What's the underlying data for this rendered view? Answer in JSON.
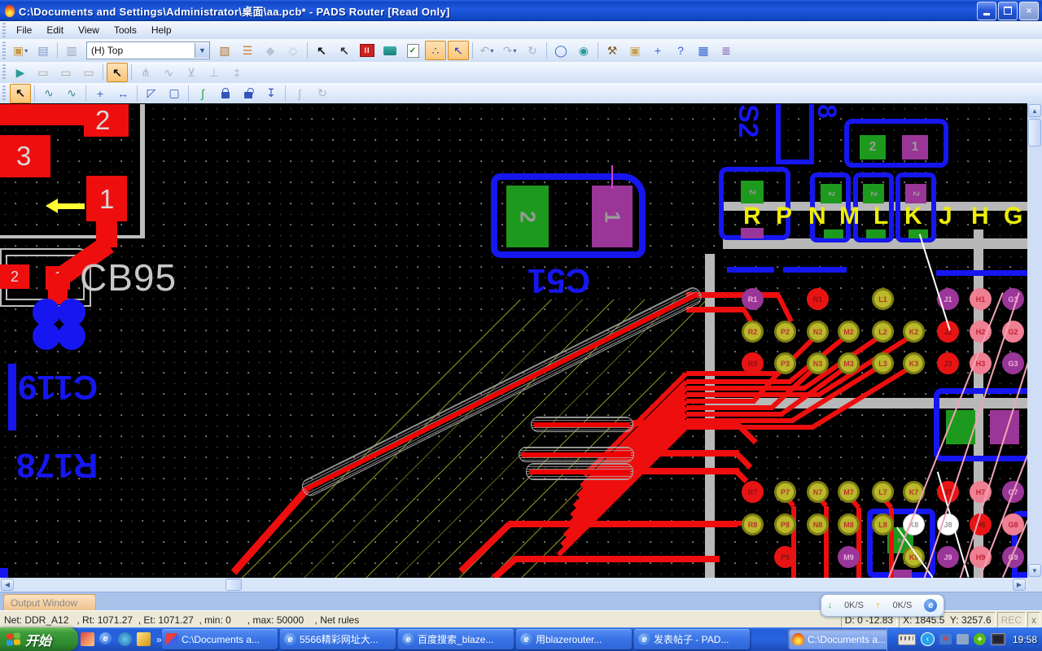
{
  "window": {
    "title": "C:\\Documents and Settings\\Administrator\\桌面\\aa.pcb* - PADS Router [Read Only]",
    "app_icon": "pads-flame-icon",
    "buttons": {
      "minimize": "minimize",
      "restore": "restore",
      "close": "close"
    }
  },
  "menu": {
    "items": [
      "File",
      "Edit",
      "View",
      "Tools",
      "Help"
    ]
  },
  "toolbars": {
    "layer_combo": {
      "value": "(H) Top"
    },
    "row1": [
      {
        "n": "open-icon",
        "g": "▣",
        "c": "#c89a4a",
        "dd": true
      },
      {
        "n": "save-icon",
        "g": "▤",
        "c": "#7d95c8"
      },
      {
        "n": "sep"
      },
      {
        "n": "print-icon",
        "g": "▥",
        "c": "#9aa8bc"
      },
      {
        "n": "combo"
      },
      {
        "n": "properties-icon",
        "g": "▧",
        "c": "#b07830"
      },
      {
        "n": "list-icon",
        "g": "☰",
        "c": "#d08030"
      },
      {
        "n": "paint-icon",
        "g": "◆",
        "c": "#b8c2d4"
      },
      {
        "n": "filter-icon",
        "g": "◇",
        "c": "#b8c2d4"
      },
      {
        "n": "sep"
      },
      {
        "n": "select-cursor-icon",
        "g": "↖",
        "c": "#111111"
      },
      {
        "n": "drc-cursor-icon",
        "g": "↖",
        "c": "#333333"
      },
      {
        "n": "pause-drc-icon",
        "g": "II",
        "c": "special-pause"
      },
      {
        "n": "autorouter-icon",
        "g": "",
        "c": "special-teal"
      },
      {
        "n": "spreadsheet-check-icon",
        "g": "✓",
        "c": "special-doc"
      },
      {
        "n": "route-view-icon",
        "g": "∴",
        "c": "#2244cc",
        "hl": true
      },
      {
        "n": "select-traces-icon",
        "g": "↖",
        "c": "#2244cc",
        "hl": true
      },
      {
        "n": "sep"
      },
      {
        "n": "undo-icon",
        "g": "↶",
        "c": "#a8b4c8",
        "dd": true
      },
      {
        "n": "redo-icon",
        "g": "↷",
        "c": "#a8b4c8",
        "dd": true
      },
      {
        "n": "refresh-icon",
        "g": "↻",
        "c": "#a8b4c8"
      },
      {
        "n": "sep"
      },
      {
        "n": "zoom-icon",
        "g": "◯",
        "c": "#3366bb"
      },
      {
        "n": "zoom-area-icon",
        "g": "◉",
        "c": "#2c9a96"
      },
      {
        "n": "sep"
      },
      {
        "n": "tools-hammer-icon",
        "g": "⚒",
        "c": "#7a5a2a"
      },
      {
        "n": "sheets-icon",
        "g": "▣",
        "c": "#c8a050"
      },
      {
        "n": "pan-icon",
        "g": "+",
        "c": "#3366cc"
      },
      {
        "n": "help-icon",
        "g": "?",
        "c": "#3366cc"
      },
      {
        "n": "table-icon",
        "g": "▦",
        "c": "#3366cc"
      },
      {
        "n": "net-comb-icon",
        "g": "≣",
        "c": "#7744aa"
      }
    ],
    "row2": [
      {
        "n": "play-icon",
        "g": "▶",
        "c": "#2c9a96"
      },
      {
        "n": "pause-gray-icon",
        "g": "▭",
        "c": "#b0a898"
      },
      {
        "n": "stop-gray-icon",
        "g": "▭",
        "c": "#b0a898"
      },
      {
        "n": "step-gray-icon",
        "g": "▭",
        "c": "#b0a898"
      },
      {
        "n": "sep"
      },
      {
        "n": "select-mode-icon",
        "g": "↖",
        "c": "#111111",
        "hl": true
      },
      {
        "n": "sep"
      },
      {
        "n": "route-start-icon",
        "g": "⋔",
        "c": "#a8b4c8"
      },
      {
        "n": "route-bundle-icon",
        "g": "∿",
        "c": "#a8b4c8"
      },
      {
        "n": "route-swap-icon",
        "g": "⊻",
        "c": "#a8b4c8"
      },
      {
        "n": "route-end-icon",
        "g": "⊥",
        "c": "#a8b4c8"
      },
      {
        "n": "route-pin-icon",
        "g": "‡",
        "c": "#a8b4c8"
      }
    ],
    "row3": [
      {
        "n": "select-mode-icon",
        "g": "↖",
        "c": "#111111",
        "hl": true
      },
      {
        "n": "sep"
      },
      {
        "n": "tune-serpentine-icon",
        "g": "∿",
        "c": "#3a8a9a"
      },
      {
        "n": "tune-accordion-icon",
        "g": "∿",
        "c": "#3a8a9a"
      },
      {
        "n": "sep"
      },
      {
        "n": "move-icon",
        "g": "+",
        "c": "#3366cc"
      },
      {
        "n": "stretch-icon",
        "g": "↔",
        "c": "#3366cc"
      },
      {
        "n": "sep"
      },
      {
        "n": "corner-select-icon",
        "g": "◸",
        "c": "#3355bb"
      },
      {
        "n": "area-select-icon",
        "g": "▢",
        "c": "#3355bb"
      },
      {
        "n": "sep"
      },
      {
        "n": "smooth-trace-icon",
        "g": "∫",
        "c": "#2b9a4a"
      },
      {
        "n": "lock-icon",
        "g": "",
        "c": "special-lock"
      },
      {
        "n": "unlock-icon",
        "g": "",
        "c": "special-unlock"
      },
      {
        "n": "pin-down-icon",
        "g": "↧",
        "c": "#3355bb"
      },
      {
        "n": "sep"
      },
      {
        "n": "curve-gray-icon",
        "g": "∫",
        "c": "#a8b4c8"
      },
      {
        "n": "rotate-gray-icon",
        "g": "↻",
        "c": "#a8b4c8"
      }
    ]
  },
  "canvas": {
    "texts": {
      "cb95": "CB95",
      "c119": "C119",
      "r178": "R178",
      "c51": "C51",
      "s2": "S2",
      "partial8": "8"
    },
    "numbers": {
      "n1": "1",
      "n2": "2",
      "n3": "3"
    },
    "bga": {
      "column_labels": [
        "R",
        "P",
        "N",
        "M",
        "L",
        "K",
        "J",
        "H",
        "G"
      ],
      "pads": [
        [
          "R1",
          925,
          368,
          "p"
        ],
        [
          "N1",
          1005,
          368,
          "r"
        ],
        [
          "L1",
          1085,
          368,
          "y"
        ],
        [
          "J1",
          1165,
          368,
          "p"
        ],
        [
          "H1",
          1205,
          368,
          "k"
        ],
        [
          "G1",
          1245,
          368,
          "p"
        ],
        [
          "R2",
          925,
          408,
          "y"
        ],
        [
          "P2",
          965,
          408,
          "y"
        ],
        [
          "N2",
          1005,
          408,
          "y"
        ],
        [
          "M2",
          1043,
          408,
          "y"
        ],
        [
          "L2",
          1085,
          408,
          "y"
        ],
        [
          "K2",
          1123,
          408,
          "y"
        ],
        [
          "J2",
          1165,
          408,
          "r"
        ],
        [
          "H2",
          1205,
          408,
          "k"
        ],
        [
          "G2",
          1245,
          408,
          "k"
        ],
        [
          "R3",
          925,
          447,
          "r"
        ],
        [
          "P3",
          965,
          447,
          "y"
        ],
        [
          "N3",
          1005,
          447,
          "y"
        ],
        [
          "M3",
          1043,
          447,
          "y"
        ],
        [
          "L3",
          1085,
          447,
          "y"
        ],
        [
          "K3",
          1123,
          447,
          "y"
        ],
        [
          "J3",
          1165,
          447,
          "r"
        ],
        [
          "H3",
          1205,
          447,
          "k"
        ],
        [
          "G3",
          1245,
          447,
          "p"
        ],
        [
          "R7",
          925,
          605,
          "r"
        ],
        [
          "P7",
          965,
          605,
          "y"
        ],
        [
          "N7",
          1005,
          605,
          "y"
        ],
        [
          "M7",
          1043,
          605,
          "y"
        ],
        [
          "L7",
          1085,
          605,
          "y"
        ],
        [
          "K7",
          1123,
          605,
          "y"
        ],
        [
          "J7",
          1165,
          605,
          "r"
        ],
        [
          "H7",
          1205,
          605,
          "k"
        ],
        [
          "G7",
          1245,
          605,
          "p"
        ],
        [
          "R8",
          925,
          645,
          "y"
        ],
        [
          "P8",
          965,
          645,
          "y"
        ],
        [
          "N8",
          1005,
          645,
          "y"
        ],
        [
          "M8",
          1043,
          645,
          "y"
        ],
        [
          "L8",
          1085,
          645,
          "y"
        ],
        [
          "K8",
          1123,
          645,
          "w"
        ],
        [
          "J8",
          1165,
          645,
          "w"
        ],
        [
          "H8",
          1205,
          645,
          "r"
        ],
        [
          "G8",
          1245,
          645,
          "k"
        ],
        [
          "P9",
          965,
          685,
          "r"
        ],
        [
          "M9",
          1043,
          685,
          "p"
        ],
        [
          "K9",
          1123,
          685,
          "y"
        ],
        [
          "J9",
          1165,
          685,
          "p"
        ],
        [
          "H9",
          1205,
          685,
          "k"
        ],
        [
          "G9",
          1245,
          685,
          "p"
        ]
      ]
    }
  },
  "output": {
    "tab": "Output Window"
  },
  "status": {
    "left": "Net: DDR_A12   , Rt: 1071.27  , Et: 1071.27  , min: 0      , max: 50000    , Net rules",
    "d": "D: 0 -12.83",
    "xy": "X: 1845.5  Y: 3257.6",
    "rec": "REC",
    "x": "x"
  },
  "speed_widget": {
    "down_label": "0K/S",
    "up_label": "0K/S",
    "browser": "e"
  },
  "taskbar": {
    "start": "开始",
    "chevron": "»",
    "buttons": [
      {
        "icon": "pads-layout-icon",
        "label": "C:\\Documents a..."
      },
      {
        "icon": "ie-icon",
        "label": "5566精彩网址大..."
      },
      {
        "icon": "ie-icon",
        "label": "百度搜索_blaze..."
      },
      {
        "icon": "ie-icon",
        "label": "用blazerouter..."
      },
      {
        "icon": "ie-icon",
        "label": "发表帖子 - PAD..."
      },
      {
        "icon": "pads-router-icon",
        "label": "C:\\Documents a...",
        "active": true
      }
    ],
    "tray_time": "19:58"
  }
}
